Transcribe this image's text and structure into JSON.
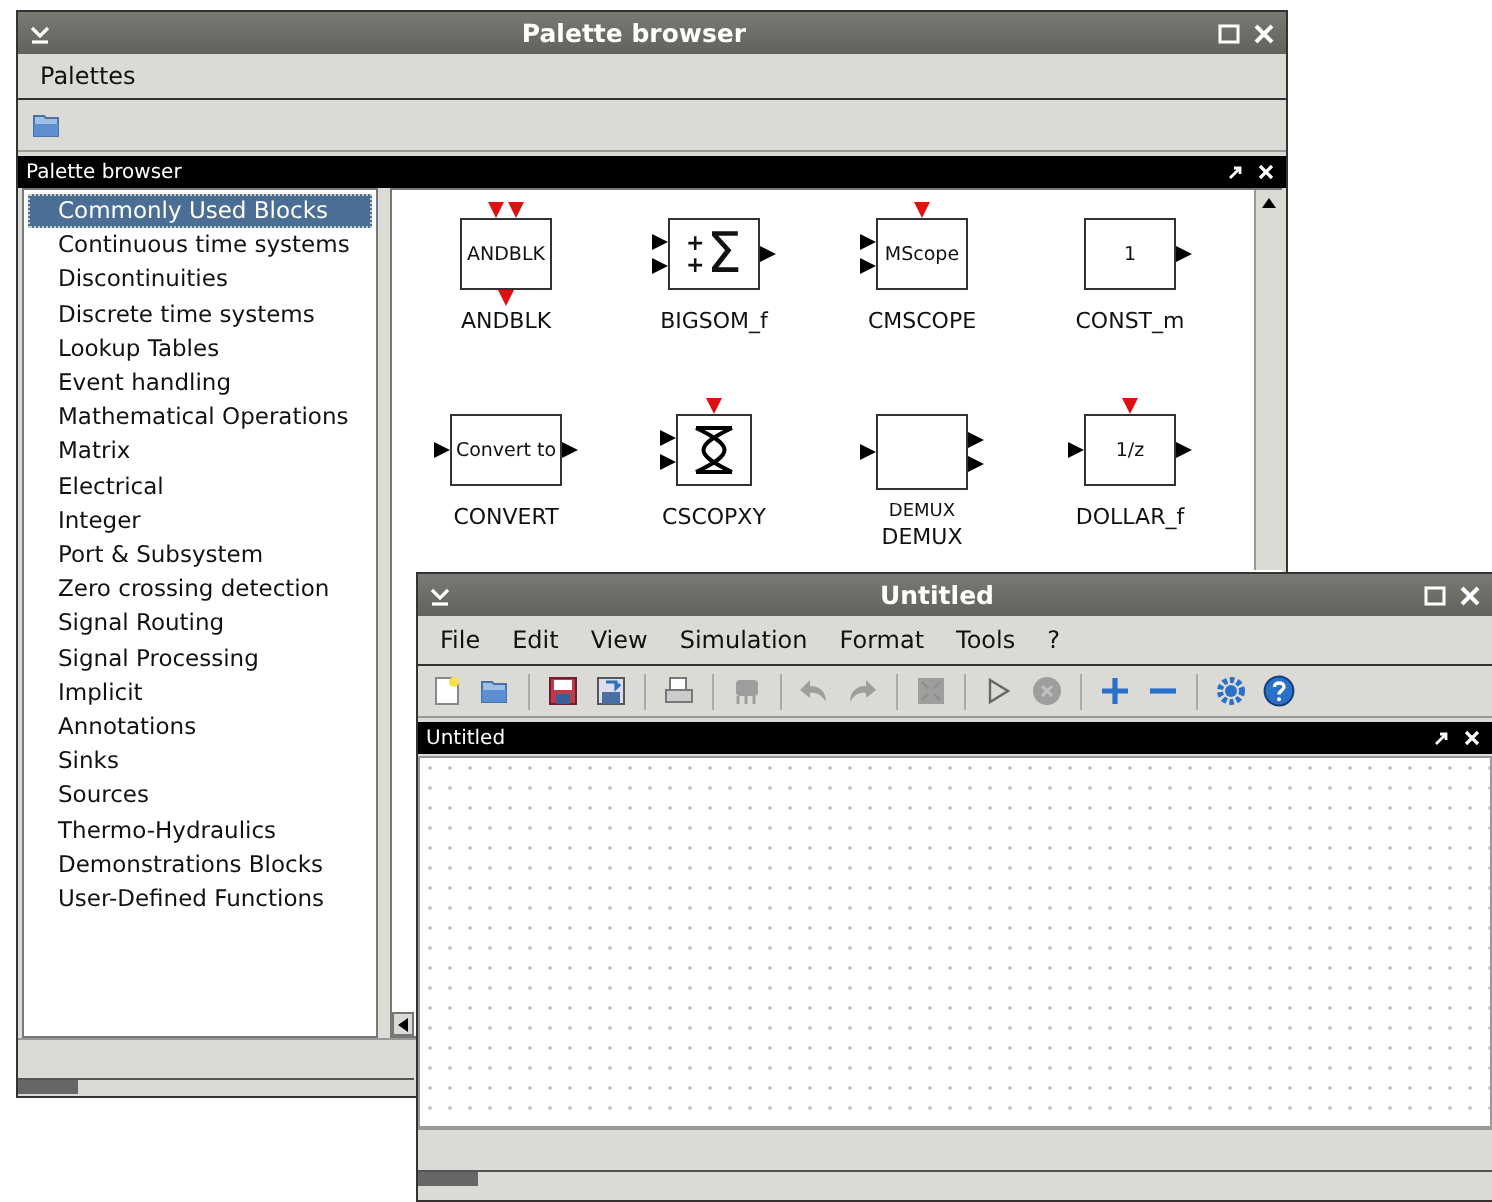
{
  "palette_window": {
    "title": "Palette browser",
    "menus": [
      {
        "label": "Palettes"
      }
    ],
    "dock_title": "Palette browser",
    "categories": [
      {
        "label": "Commonly Used Blocks",
        "selected": true
      },
      {
        "label": "Continuous time systems",
        "selected": false
      },
      {
        "label": "Discontinuities",
        "selected": false
      },
      {
        "label": "Discrete time systems",
        "selected": false
      },
      {
        "label": "Lookup Tables",
        "selected": false
      },
      {
        "label": "Event handling",
        "selected": false
      },
      {
        "label": "Mathematical Operations",
        "selected": false
      },
      {
        "label": "Matrix",
        "selected": false
      },
      {
        "label": "Electrical",
        "selected": false
      },
      {
        "label": "Integer",
        "selected": false
      },
      {
        "label": "Port & Subsystem",
        "selected": false
      },
      {
        "label": "Zero crossing detection",
        "selected": false
      },
      {
        "label": "Signal Routing",
        "selected": false
      },
      {
        "label": "Signal Processing",
        "selected": false
      },
      {
        "label": "Implicit",
        "selected": false
      },
      {
        "label": "Annotations",
        "selected": false
      },
      {
        "label": "Sinks",
        "selected": false
      },
      {
        "label": "Sources",
        "selected": false
      },
      {
        "label": "Thermo-Hydraulics",
        "selected": false
      },
      {
        "label": "Demonstrations Blocks",
        "selected": false
      },
      {
        "label": "User-Defined Functions",
        "selected": false
      }
    ],
    "blocks": [
      {
        "kind": "logic",
        "symbol": "ANDBLK",
        "name": "ANDBLK"
      },
      {
        "kind": "sum",
        "symbol": "Σ",
        "signs": [
          "+",
          "+"
        ],
        "name": "BIGSOM_f"
      },
      {
        "kind": "scope",
        "symbol": "MScope",
        "name": "CMSCOPE"
      },
      {
        "kind": "source",
        "symbol": "1",
        "name": "CONST_m"
      },
      {
        "kind": "convert",
        "symbol": "Convert to",
        "name": "CONVERT"
      },
      {
        "kind": "xy",
        "name": "CSCOPXY"
      },
      {
        "kind": "demux",
        "symbol": "DEMUX",
        "name": "DEMUX"
      },
      {
        "kind": "delay",
        "symbol": "1/z",
        "name": "DOLLAR_f"
      }
    ]
  },
  "diagram_window": {
    "title": "Untitled",
    "menus": [
      {
        "label": "File"
      },
      {
        "label": "Edit"
      },
      {
        "label": "View"
      },
      {
        "label": "Simulation"
      },
      {
        "label": "Format"
      },
      {
        "label": "Tools"
      },
      {
        "label": "?"
      }
    ],
    "toolbar": [
      {
        "kind": "new",
        "disabled": false
      },
      {
        "kind": "open",
        "disabled": false
      },
      {
        "kind": "separator"
      },
      {
        "kind": "save",
        "disabled": false
      },
      {
        "kind": "saveas",
        "disabled": false
      },
      {
        "kind": "separator"
      },
      {
        "kind": "print",
        "disabled": false
      },
      {
        "kind": "separator"
      },
      {
        "kind": "compile",
        "disabled": true
      },
      {
        "kind": "separator"
      },
      {
        "kind": "undo",
        "disabled": true
      },
      {
        "kind": "redo",
        "disabled": true
      },
      {
        "kind": "separator"
      },
      {
        "kind": "fit",
        "disabled": true
      },
      {
        "kind": "separator"
      },
      {
        "kind": "start",
        "disabled": false
      },
      {
        "kind": "stop",
        "disabled": true
      },
      {
        "kind": "separator"
      },
      {
        "kind": "zoomin",
        "disabled": false
      },
      {
        "kind": "zoomout",
        "disabled": false
      },
      {
        "kind": "separator"
      },
      {
        "kind": "settings",
        "disabled": false
      },
      {
        "kind": "help",
        "disabled": false
      }
    ],
    "dock_title": "Untitled"
  }
}
